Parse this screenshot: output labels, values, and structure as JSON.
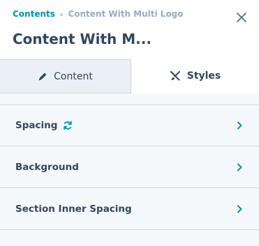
{
  "breadcrumb": {
    "link": "Contents",
    "separator": "›",
    "current": "Content With Multi Logo"
  },
  "panel_title": "Content With M...",
  "tabs": [
    {
      "label": "Content",
      "icon": "pencil-icon",
      "active": false
    },
    {
      "label": "Styles",
      "icon": "brush-icon",
      "active": true
    }
  ],
  "sections": [
    {
      "label": "Spacing",
      "extra_icon": "sync-icon"
    },
    {
      "label": "Background"
    },
    {
      "label": "Section Inner Spacing"
    }
  ],
  "colors": {
    "accent": "#0091ae",
    "text": "#33475b",
    "muted": "#99acc2",
    "border": "#cbd6e2",
    "inactive_tab_bg": "#eaf0f6",
    "panel_bg": "#f5f8fa"
  }
}
